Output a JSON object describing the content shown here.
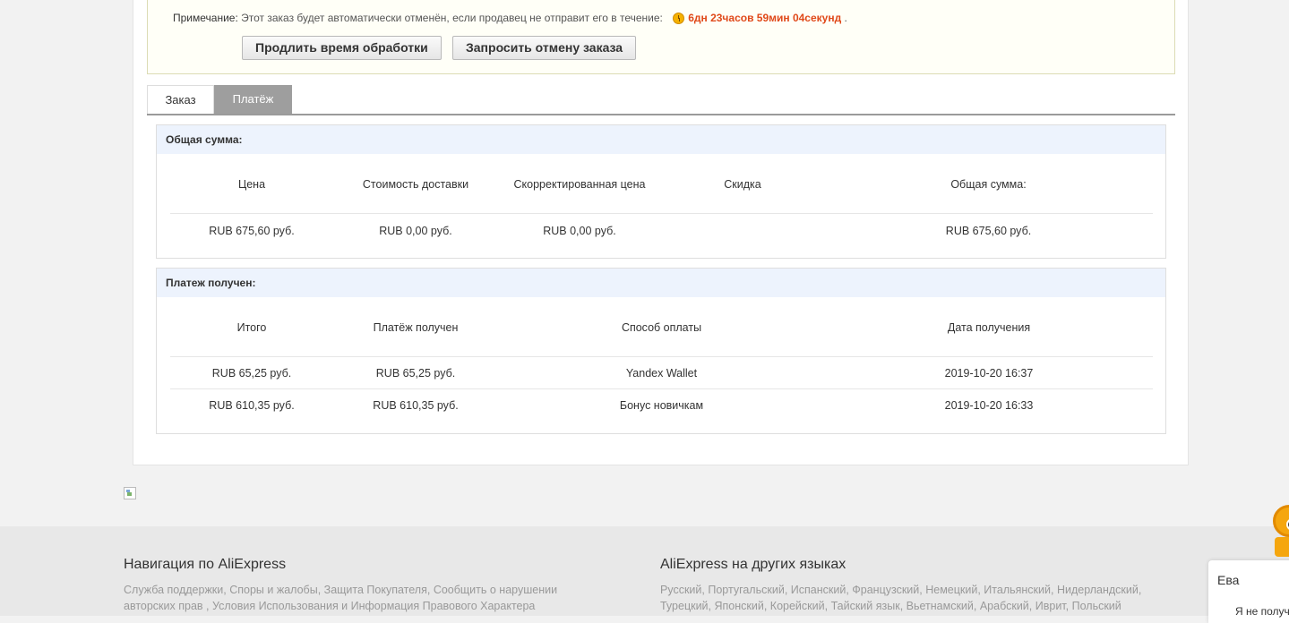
{
  "notice": {
    "label": "Примечание:",
    "text": "Этот заказ будет автоматически отменён, если продавец не отправит его в течение:",
    "countdown": "6дн 23часов 59мин 04секунд",
    "suffix": ".",
    "icon": "timer-icon",
    "countdown_color": "#e0491a"
  },
  "actions": {
    "extend_label": "Продлить время обработки",
    "cancel_label": "Запросить отмену заказа"
  },
  "tabs": [
    {
      "label": "Заказ",
      "active": false
    },
    {
      "label": "Платёж",
      "active": true
    }
  ],
  "total_section": {
    "title": "Общая сумма:",
    "columns": [
      "Цена",
      "Стоимость доставки",
      "Скорректированная цена",
      "Скидка",
      "Общая сумма:"
    ],
    "rows": [
      [
        "RUB 675,60 руб.",
        "RUB 0,00 руб.",
        "RUB 0,00 руб.",
        "",
        "RUB 675,60 руб."
      ]
    ]
  },
  "payment_section": {
    "title": "Платеж получен:",
    "columns": [
      "Итого",
      "Платёж получен",
      "Способ оплаты",
      "Дата получения"
    ],
    "rows": [
      [
        "RUB 65,25 руб.",
        "RUB 65,25 руб.",
        "Yandex Wallet",
        "2019-10-20 16:37"
      ],
      [
        "RUB 610,35 руб.",
        "RUB 610,35 руб.",
        "Бонус новичкам",
        "2019-10-20 16:33"
      ]
    ]
  },
  "footer": {
    "nav_title": "Навигация по AliExpress",
    "nav_links": [
      "Служба поддержки",
      "Споры и жалобы",
      "Защита Покупателя",
      "Сообщить о нарушении авторских прав",
      "Условия Использования и Информация Правового Характера"
    ],
    "lang_title": "AliExpress на других языках",
    "lang_links": [
      "Русский",
      "Португальский",
      "Испанский",
      "Французский",
      "Немецкий",
      "Итальянский",
      "Нидерландский",
      "Турецкий",
      "Японский",
      "Корейский",
      "Тайский язык",
      "Вьетнамский",
      "Арабский",
      "Иврит",
      "Польский"
    ]
  },
  "chat": {
    "name": "Ева",
    "preview": "Я не получ"
  },
  "colors": {
    "section_header_bg": "#edf3fd",
    "tab_active_bg": "#9e9e9e",
    "footer_bg": "#e8e8e8"
  }
}
